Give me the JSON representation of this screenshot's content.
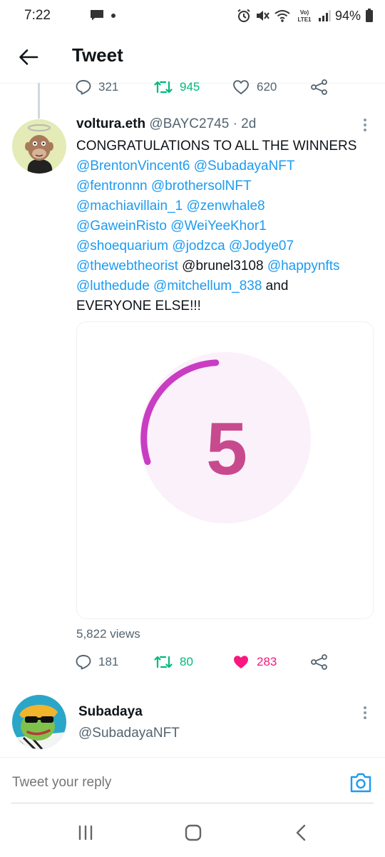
{
  "status_bar": {
    "time": "7:22",
    "battery": "94%",
    "icons": [
      "message-icon",
      "alarm-icon",
      "mute-icon",
      "wifi-icon",
      "volte-icon",
      "signal-icon",
      "battery-icon"
    ]
  },
  "header": {
    "title": "Tweet",
    "back_icon": "arrow-left-icon"
  },
  "parent_tweet_actions": {
    "replies": "321",
    "retweets": "945",
    "likes": "620"
  },
  "tweet": {
    "name": "voltura.eth",
    "handle_time": "@BAYC2745 · 2d",
    "lines": [
      [
        {
          "t": "CONGRATULATIONS TO ALL THE WINNERS",
          "m": false
        }
      ],
      [
        {
          "t": "@BrentonVincent6",
          "m": true
        },
        {
          "t": " ",
          "m": false
        },
        {
          "t": "@SubadayaNFT",
          "m": true
        }
      ],
      [
        {
          "t": "@fentronnn",
          "m": true
        },
        {
          "t": " ",
          "m": false
        },
        {
          "t": "@brothersolNFT",
          "m": true
        }
      ],
      [
        {
          "t": "@machiavillain_1",
          "m": true
        },
        {
          "t": " ",
          "m": false
        },
        {
          "t": "@zenwhale8",
          "m": true
        }
      ],
      [
        {
          "t": "@GaweinRisto",
          "m": true
        },
        {
          "t": " ",
          "m": false
        },
        {
          "t": "@WeiYeeKhor1",
          "m": true
        }
      ],
      [
        {
          "t": "@shoequarium",
          "m": true
        },
        {
          "t": " ",
          "m": false
        },
        {
          "t": "@jodzca",
          "m": true
        },
        {
          "t": " ",
          "m": false
        },
        {
          "t": "@Jodye07",
          "m": true
        }
      ],
      [
        {
          "t": "@thewebtheorist",
          "m": true
        },
        {
          "t": " @brunel3108 ",
          "m": false
        },
        {
          "t": "@happynfts",
          "m": true
        }
      ],
      [
        {
          "t": "@luthedude",
          "m": true
        },
        {
          "t": " ",
          "m": false
        },
        {
          "t": "@mitchellum_838",
          "m": true
        },
        {
          "t": " and",
          "m": false
        }
      ],
      [
        {
          "t": "EVERYONE ELSE!!!",
          "m": false
        }
      ]
    ],
    "media": {
      "countdown_number": "5",
      "ring_color": "#c93dc3",
      "number_color": "#c84a8e",
      "circle_bg": "#fbf1fa"
    },
    "views": "5,822 views",
    "actions": {
      "replies": "181",
      "retweets": "80",
      "likes": "283",
      "liked": true
    }
  },
  "reply_user": {
    "name": "Subadaya",
    "handle": "@SubadayaNFT"
  },
  "compose": {
    "placeholder": "Tweet your reply",
    "camera_icon": "camera-icon"
  },
  "colors": {
    "accent": "#1d9bf0",
    "retweet": "#00ba7c",
    "like": "#f91880",
    "secondary_text": "#536471"
  },
  "nav": {
    "icons": [
      "recents-icon",
      "home-icon",
      "back-icon"
    ]
  }
}
